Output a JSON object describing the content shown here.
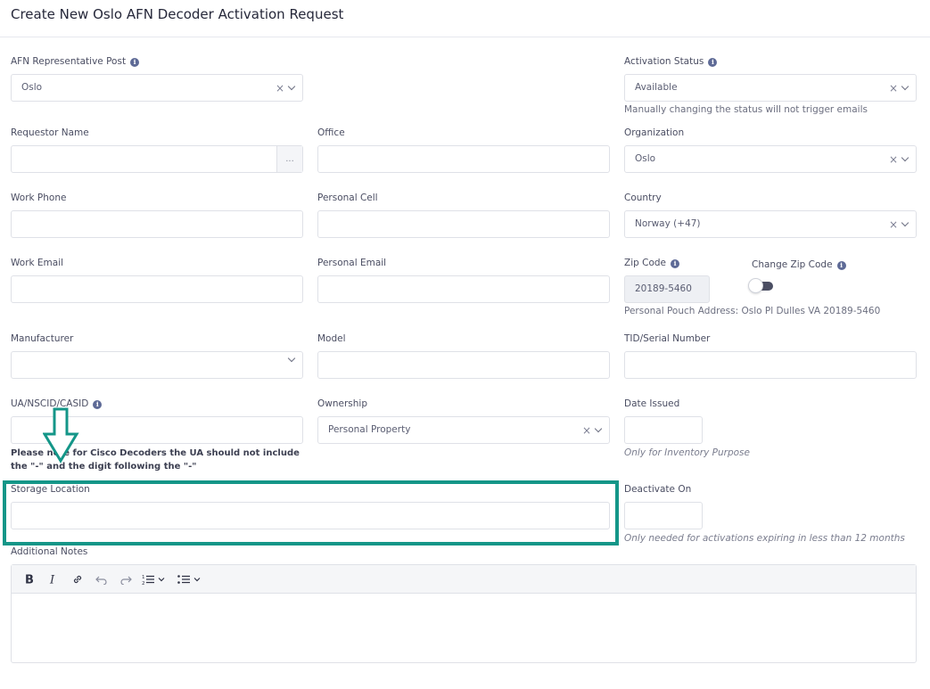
{
  "header": {
    "title": "Create New Oslo AFN Decoder Activation Request"
  },
  "fields": {
    "afn_post": {
      "label": "AFN Representative Post",
      "value": "Oslo"
    },
    "activation_status": {
      "label": "Activation Status",
      "value": "Available",
      "help": "Manually changing the status will not trigger emails"
    },
    "requestor_name": {
      "label": "Requestor Name",
      "value": "",
      "addon": "..."
    },
    "office": {
      "label": "Office",
      "value": ""
    },
    "organization": {
      "label": "Organization",
      "value": "Oslo"
    },
    "work_phone": {
      "label": "Work Phone",
      "value": ""
    },
    "personal_cell": {
      "label": "Personal Cell",
      "value": ""
    },
    "country": {
      "label": "Country",
      "value": "Norway (+47)"
    },
    "work_email": {
      "label": "Work Email",
      "value": ""
    },
    "personal_email": {
      "label": "Personal Email",
      "value": ""
    },
    "zip_code": {
      "label": "Zip Code",
      "value": "20189-5460",
      "help": "Personal Pouch Address: Oslo Pl Dulles VA 20189-5460"
    },
    "change_zip": {
      "label": "Change Zip Code",
      "checked": false
    },
    "manufacturer": {
      "label": "Manufacturer",
      "value": ""
    },
    "model": {
      "label": "Model",
      "value": ""
    },
    "tid_serial": {
      "label": "TID/Serial Number",
      "value": ""
    },
    "ua_nscid": {
      "label": "UA/NSCID/CASID",
      "value": "",
      "note": "Please note for Cisco Decoders the UA should not include the \"-\" and the digit following the \"-\""
    },
    "ownership": {
      "label": "Ownership",
      "value": "Personal Property"
    },
    "date_issued": {
      "label": "Date Issued",
      "value": "",
      "help": "Only for Inventory Purpose"
    },
    "storage_location": {
      "label": "Storage Location",
      "value": ""
    },
    "deactivate_on": {
      "label": "Deactivate On",
      "value": "",
      "help": "Only needed for activations expiring in less than 12 months"
    },
    "additional_notes": {
      "label": "Additional Notes",
      "value": ""
    }
  },
  "icons": {
    "info": "info-circle-icon",
    "clear": "x-icon",
    "dropdown": "chevron-down-icon",
    "annotation_arrow": "down-arrow-icon"
  },
  "colors": {
    "accent": "#149688",
    "info": "#5e6a96",
    "toggle_off": "#4b4e63"
  }
}
